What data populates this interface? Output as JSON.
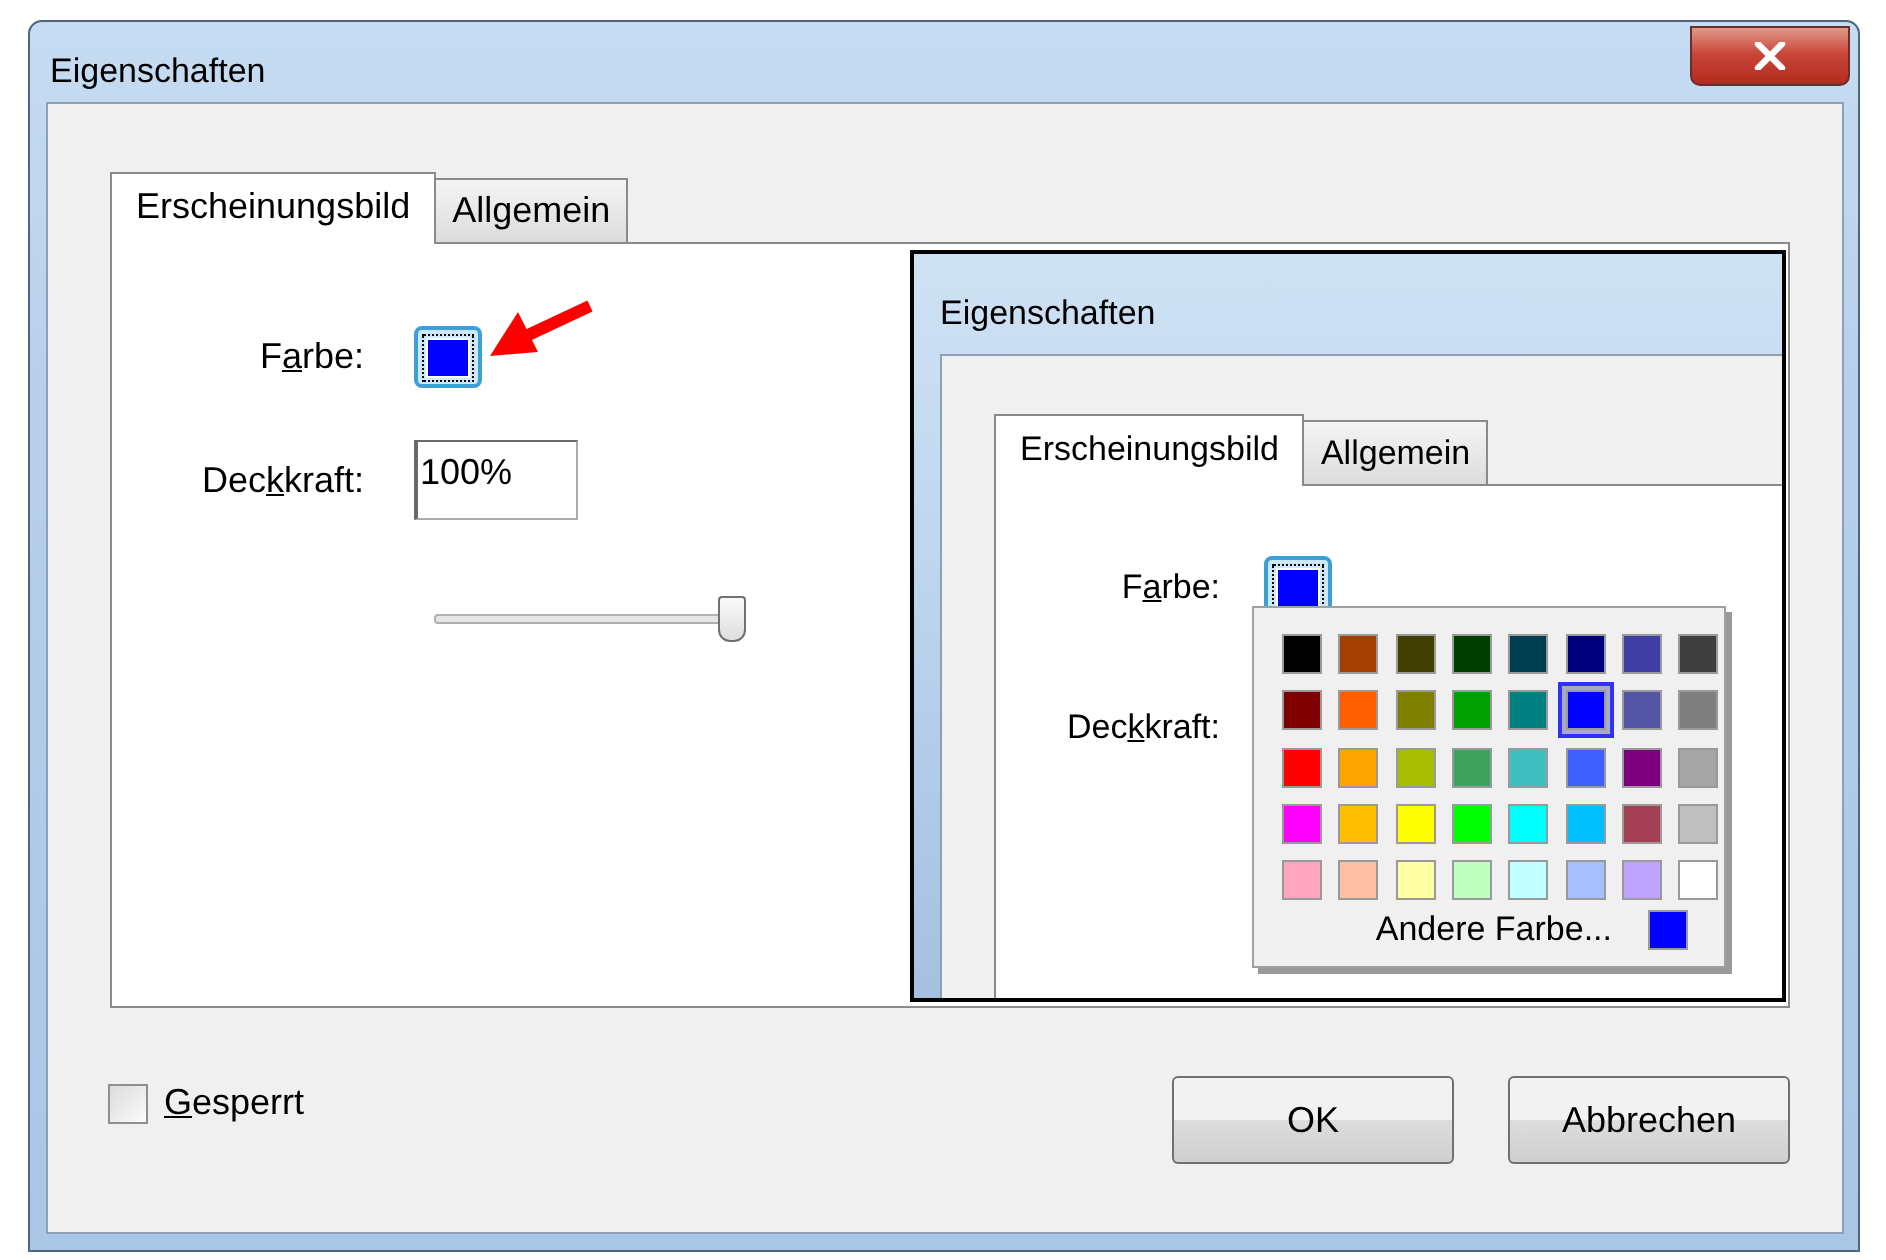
{
  "window": {
    "title": "Eigenschaften"
  },
  "tabs": [
    {
      "label": "Erscheinungsbild",
      "selected": true
    },
    {
      "label": "Allgemein",
      "selected": false
    }
  ],
  "color_field": {
    "label_parts": [
      {
        "text": "F",
        "underline": false
      },
      {
        "text": "a",
        "underline": true
      },
      {
        "text": "rbe:",
        "underline": false
      }
    ],
    "color": "#0000ff"
  },
  "opacity_field": {
    "label_parts": [
      {
        "text": "Dec",
        "underline": false
      },
      {
        "text": "k",
        "underline": true
      },
      {
        "text": "kraft:",
        "underline": false
      }
    ],
    "value": "100%"
  },
  "opacity_slider": {
    "level": 1
  },
  "inset_screenshot": {
    "window": {
      "title": "Eigenschaften"
    },
    "tabs": [
      {
        "label": "Erscheinungsbild",
        "selected": true
      },
      {
        "label": "Allgemein",
        "selected": false
      }
    ],
    "color_label_parts": [
      {
        "text": "F",
        "underline": false
      },
      {
        "text": "a",
        "underline": true
      },
      {
        "text": "rbe:",
        "underline": false
      }
    ],
    "color": "#0000ff",
    "opacity_label_parts": [
      {
        "text": "Dec",
        "underline": false
      },
      {
        "text": "k",
        "underline": true
      },
      {
        "text": "kraft:",
        "underline": false
      }
    ],
    "palette": {
      "swatches": [
        {
          "color": "#000000",
          "selected": false
        },
        {
          "color": "#a33f00",
          "selected": false
        },
        {
          "color": "#3f3f00",
          "selected": false
        },
        {
          "color": "#003f00",
          "selected": false
        },
        {
          "color": "#003f4f",
          "selected": false
        },
        {
          "color": "#00007f",
          "selected": false
        },
        {
          "color": "#3f3fa3",
          "selected": false
        },
        {
          "color": "#3f3f3f",
          "selected": false
        },
        {
          "color": "#7f0000",
          "selected": false
        },
        {
          "color": "#ff5f00",
          "selected": false
        },
        {
          "color": "#7f7f00",
          "selected": false
        },
        {
          "color": "#00a000",
          "selected": false
        },
        {
          "color": "#007f7f",
          "selected": false
        },
        {
          "color": "#0000ff",
          "selected": true
        },
        {
          "color": "#5555a5",
          "selected": false
        },
        {
          "color": "#7f7f7f",
          "selected": false
        },
        {
          "color": "#ff0000",
          "selected": false
        },
        {
          "color": "#ffa500",
          "selected": false
        },
        {
          "color": "#a5bf00",
          "selected": false
        },
        {
          "color": "#3fa35f",
          "selected": false
        },
        {
          "color": "#3fbfbf",
          "selected": false
        },
        {
          "color": "#3f5fff",
          "selected": false
        },
        {
          "color": "#7f007f",
          "selected": false
        },
        {
          "color": "#a5a5a5",
          "selected": false
        },
        {
          "color": "#ff00ff",
          "selected": false
        },
        {
          "color": "#ffbf00",
          "selected": false
        },
        {
          "color": "#ffff00",
          "selected": false
        },
        {
          "color": "#00ff00",
          "selected": false
        },
        {
          "color": "#00ffff",
          "selected": false
        },
        {
          "color": "#00bfff",
          "selected": false
        },
        {
          "color": "#a53f55",
          "selected": false
        },
        {
          "color": "#bfbfbf",
          "selected": false
        },
        {
          "color": "#ffa5bf",
          "selected": false
        },
        {
          "color": "#ffbfa5",
          "selected": false
        },
        {
          "color": "#ffffa5",
          "selected": false
        },
        {
          "color": "#bfffbf",
          "selected": false
        },
        {
          "color": "#bfffff",
          "selected": false
        },
        {
          "color": "#a5bfff",
          "selected": false
        },
        {
          "color": "#bfa5ff",
          "selected": false
        },
        {
          "color": "#ffffff",
          "selected": false
        }
      ],
      "more_label": "Andere Farbe...",
      "more_swatch": {
        "color": "#0000ff"
      }
    }
  },
  "locked_checkbox": {
    "label_parts": [
      {
        "text": "G",
        "underline": true
      },
      {
        "text": "esperrt",
        "underline": false
      }
    ],
    "checked": false
  },
  "buttons": [
    {
      "label": "OK"
    },
    {
      "label": "Abbrechen"
    }
  ]
}
